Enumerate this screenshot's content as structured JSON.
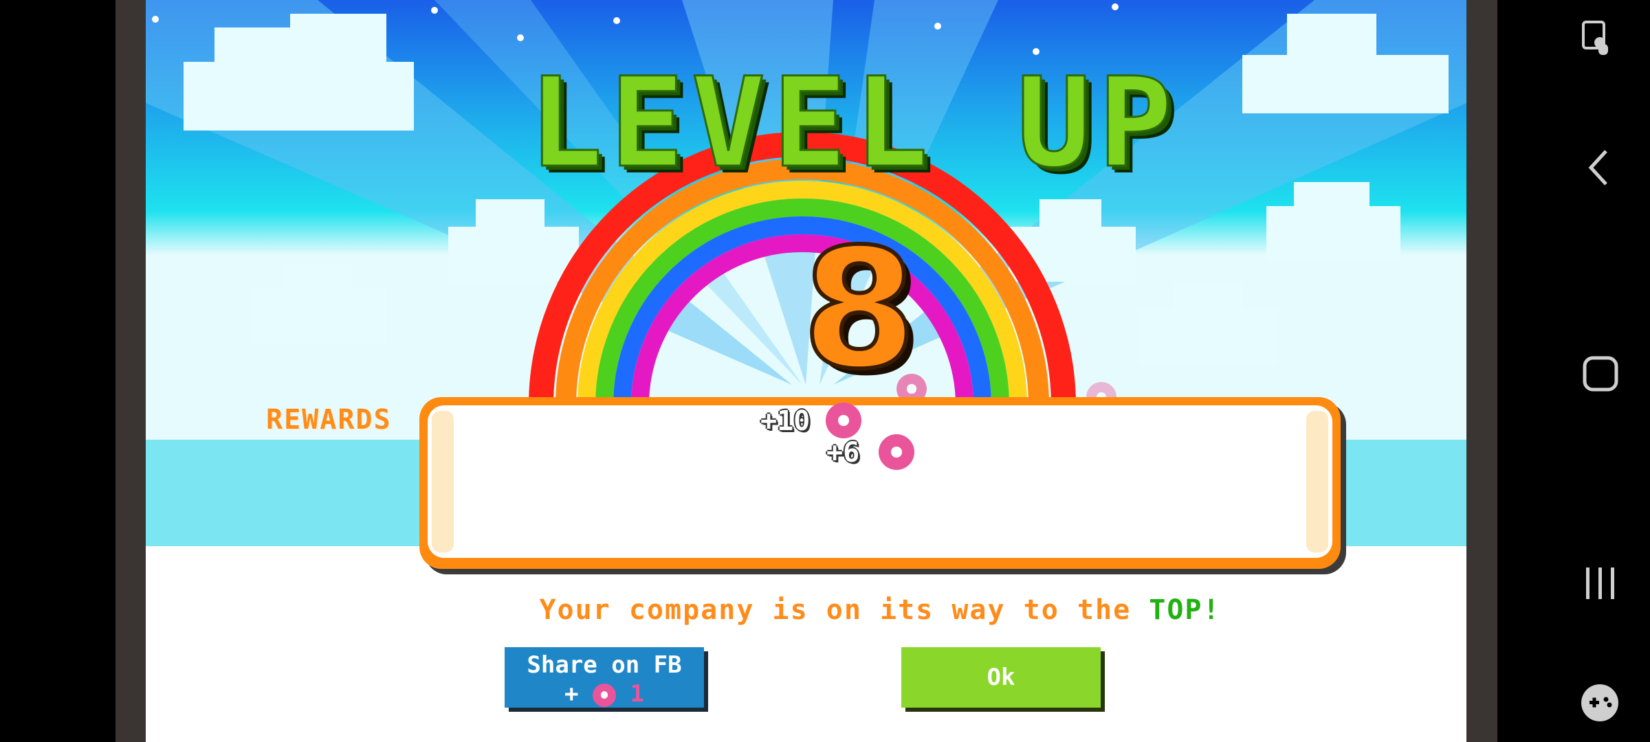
{
  "game": {
    "title": "LEVEL UP",
    "level": "8",
    "rewards_label": "REWARDS",
    "rewards": [
      {
        "amount": "+10",
        "icon": "donut-icon"
      },
      {
        "amount": "+6",
        "icon": "donut-icon"
      }
    ],
    "message_prefix": "Your company is on its way to the ",
    "message_highlight": "TOP!",
    "share_button": {
      "label": "Share on FB",
      "reward_prefix": "+",
      "reward_amount": "1",
      "reward_icon": "donut-icon"
    },
    "ok_button": {
      "label": "Ok"
    }
  },
  "system_nav": {
    "icons": [
      "screen-lock-touch-icon",
      "back-icon",
      "home-icon",
      "recents-icon",
      "game-launcher-icon"
    ]
  },
  "colors": {
    "title_green": "#7fd41e",
    "level_orange": "#ff8a12",
    "rewards_orange": "#ff8c1a",
    "highlight_green": "#22b012",
    "fb_blue": "#1f86c8",
    "ok_green": "#8ad62a",
    "donut_pink": "#e9549a"
  }
}
